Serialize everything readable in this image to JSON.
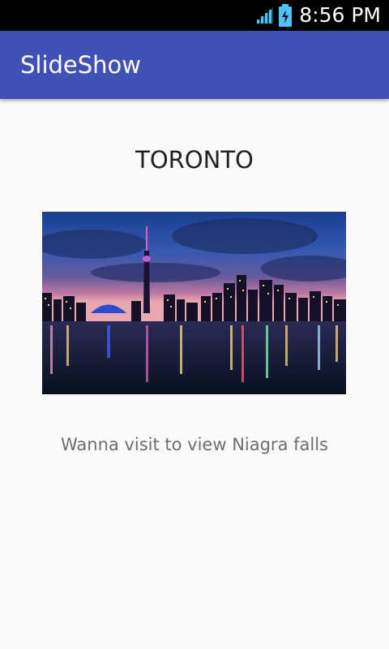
{
  "status_bar": {
    "time": "8:56 PM",
    "icons": [
      "signal-icon",
      "battery-charging-icon"
    ]
  },
  "app_bar": {
    "title": "SlideShow"
  },
  "slide": {
    "title": "TORONTO",
    "image_subject": "toronto-skyline-night-icon",
    "caption": "Wanna visit to view Niagra falls"
  },
  "colors": {
    "status_bar": "#000000",
    "app_bar": "#3f51b5",
    "background": "#fafafa",
    "battery": "#4fc3f7"
  }
}
